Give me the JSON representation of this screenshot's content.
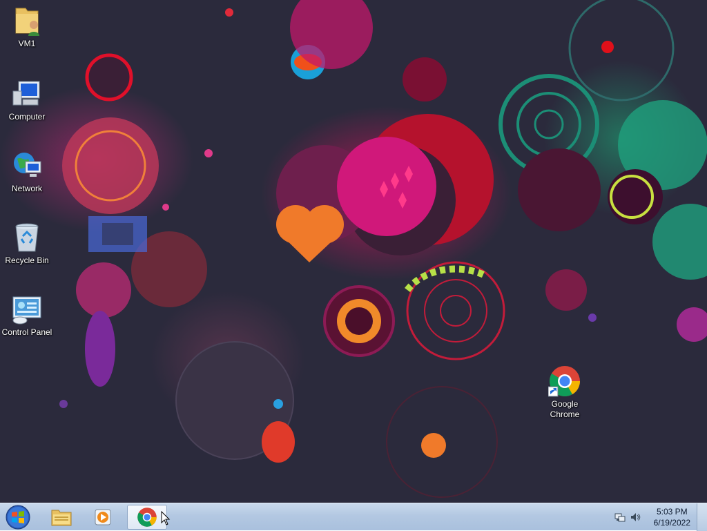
{
  "desktop": {
    "icons": [
      {
        "id": "vm1",
        "label": "VM1",
        "icon": "user-folder-icon"
      },
      {
        "id": "computer",
        "label": "Computer",
        "icon": "computer-icon"
      },
      {
        "id": "network",
        "label": "Network",
        "icon": "network-globe-icon"
      },
      {
        "id": "recycle-bin",
        "label": "Recycle Bin",
        "icon": "recycle-bin-icon"
      },
      {
        "id": "control-panel",
        "label": "Control Panel",
        "icon": "control-panel-icon"
      },
      {
        "id": "google-chrome",
        "label": "Google Chrome",
        "icon": "chrome-shortcut-icon"
      }
    ]
  },
  "taskbar": {
    "start_icon": "windows-start-icon",
    "pinned": [
      {
        "name": "windows-explorer",
        "icon": "folder-icon",
        "active": false
      },
      {
        "name": "media-player",
        "icon": "media-player-icon",
        "active": false
      },
      {
        "name": "google-chrome",
        "icon": "chrome-icon",
        "active": true
      }
    ],
    "tray": {
      "icons": [
        "network-tray-icon",
        "volume-icon"
      ],
      "time": "5:03 PM",
      "date": "6/19/2022"
    }
  },
  "colors": {
    "taskbar": "#b3c8e2",
    "desktop_bg": "#2b2a3c",
    "accent_pink": "#d81b6a",
    "accent_teal": "#1aa88a"
  }
}
